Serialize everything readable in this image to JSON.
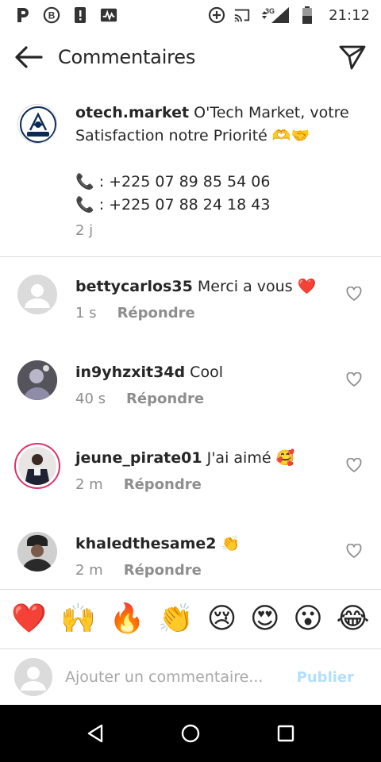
{
  "status_bar": {
    "time": "21:12",
    "network": "3G",
    "icons": [
      "p-app-icon",
      "b-app-icon",
      "sim-alert-icon",
      "activity-icon",
      "add-circle-icon",
      "cast-icon",
      "signal-icon",
      "battery-icon"
    ]
  },
  "header": {
    "title": "Commentaires",
    "back_icon": "arrow-left-icon",
    "share_icon": "send-icon"
  },
  "caption": {
    "username": "otech.market",
    "text": "O'Tech Market, votre Satisfaction notre Priorité 🫶🤝",
    "phone1": "📞 : +225 07 89 85 54 06",
    "phone2": "📞 : +225 07 88 24 18 43",
    "time": "2 j"
  },
  "comments": [
    {
      "username": "bettycarlos35",
      "text": "Merci a vous ❤️",
      "time": "1 s",
      "reply": "Répondre"
    },
    {
      "username": "in9yhzxit34d",
      "text": "Cool",
      "time": "40 s",
      "reply": "Répondre"
    },
    {
      "username": "jeune_pirate01",
      "text": "J'ai aimé 🥰",
      "time": "2 m",
      "reply": "Répondre"
    },
    {
      "username": "khaledthesame2",
      "text": "👏",
      "time": "2 m",
      "reply": "Répondre"
    }
  ],
  "emoji_bar": [
    "❤️",
    "🙌",
    "🔥",
    "👏",
    "😢",
    "😍",
    "😮",
    "😂"
  ],
  "input": {
    "placeholder": "Ajouter un commentaire...",
    "publish": "Publier"
  },
  "colors": {
    "text": "#262626",
    "muted": "#8e8e8e",
    "publish_disabled": "#b2dffc",
    "story_ring": "#e1306c"
  }
}
